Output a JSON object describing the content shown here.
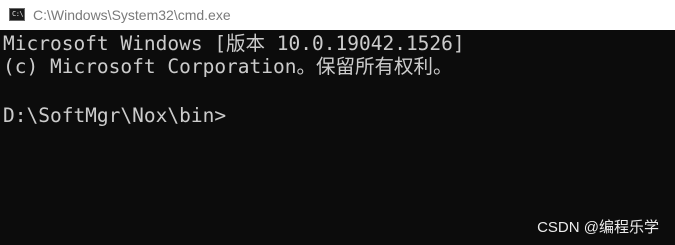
{
  "window": {
    "title": "C:\\Windows\\System32\\cmd.exe",
    "icon": "console-icon"
  },
  "console": {
    "lines": [
      "Microsoft Windows [版本 10.0.19042.1526]",
      "(c) Microsoft Corporation。保留所有权利。",
      "",
      "D:\\SoftMgr\\Nox\\bin>"
    ]
  },
  "watermark": "CSDN @编程乐学",
  "colors": {
    "console_background": "#0c0c0c",
    "console_text": "#cccccc",
    "titlebar_background": "#ffffff",
    "titlebar_text": "#7a7a7a"
  }
}
